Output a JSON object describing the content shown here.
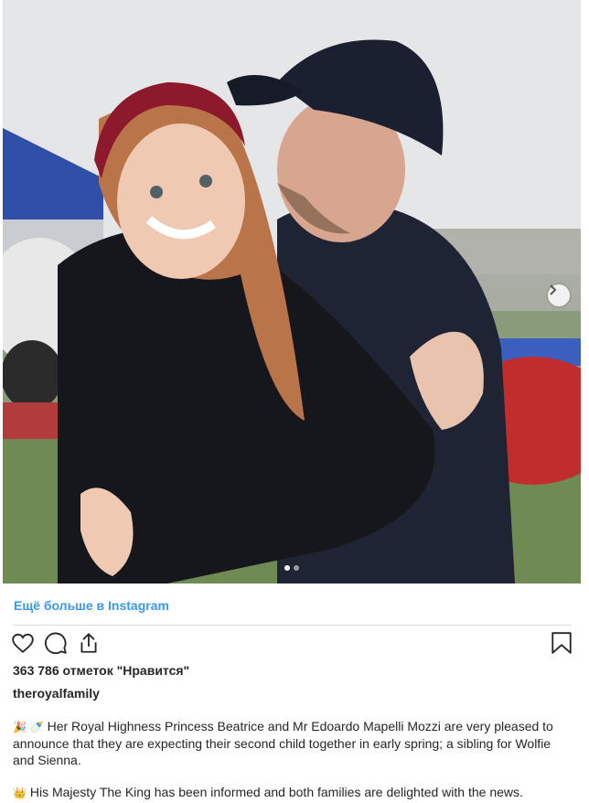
{
  "more_link": "Ещё больше в Instagram",
  "likes": "363 786 отметок \"Нравится\"",
  "username": "theroyalfamily",
  "caption": {
    "p1_emoji": "🎉 🍼",
    "p1_text": "Her Royal Highness Princess Beatrice and Mr Edoardo Mapelli Mozzi are very pleased to announce that they are expecting their second child together in early spring; a sibling for Wolfie and Sienna.",
    "p2_emoji": "👑",
    "p2_text": "His Majesty The King has been informed and both families are delighted with the news."
  },
  "carousel": {
    "current": 1,
    "total": 2
  },
  "icons": {
    "like": "heart-icon",
    "comment": "comment-icon",
    "share": "share-icon",
    "save": "bookmark-icon",
    "next": "chevron-right-icon"
  },
  "colors": {
    "link": "#3897f0",
    "text": "#262626",
    "divider": "#dbdbdb"
  }
}
